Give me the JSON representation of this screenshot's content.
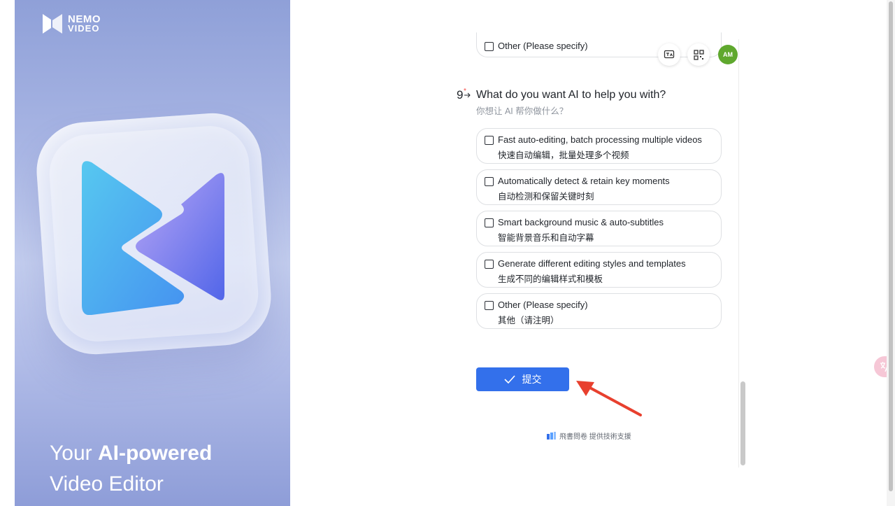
{
  "hero": {
    "logo": {
      "line1": "NEMO",
      "line2": "VIDEO"
    },
    "tagline_prefix": "Your ",
    "tagline_bold": "AI-powered",
    "tagline_line2": "Video Editor"
  },
  "form": {
    "prev_option_partial": "Other (Please specify)",
    "question": {
      "number": "9",
      "required_mark": "*",
      "title": "What do you want AI to help you with?",
      "subtitle": "你想让 AI 帮你做什么？",
      "options": [
        {
          "en": "Fast auto-editing, batch processing multiple videos",
          "zh": "快速自动编辑，批量处理多个视频",
          "checked": false
        },
        {
          "en": "Automatically detect & retain key moments",
          "zh": "自动检测和保留关键时刻",
          "checked": false
        },
        {
          "en": "Smart background music & auto-subtitles",
          "zh": "智能背景音乐和自动字幕",
          "checked": false
        },
        {
          "en": "Generate different editing styles and templates",
          "zh": "生成不同的编辑样式和模板",
          "checked": false
        },
        {
          "en": "Other (Please specify)",
          "zh": "其他（请注明）",
          "checked": false
        }
      ]
    },
    "submit_label": "提交",
    "footer": "飛書問卷 提供技術支援"
  },
  "toolbar": {
    "avatar_initials": "AM",
    "icons": [
      "translate-doc-icon",
      "qr-code-icon"
    ]
  },
  "colors": {
    "accent": "#3370eb",
    "avatar": "#5fa82e",
    "arrow": "#e8402e",
    "hero_gradient_top": "#8fa0d8"
  }
}
